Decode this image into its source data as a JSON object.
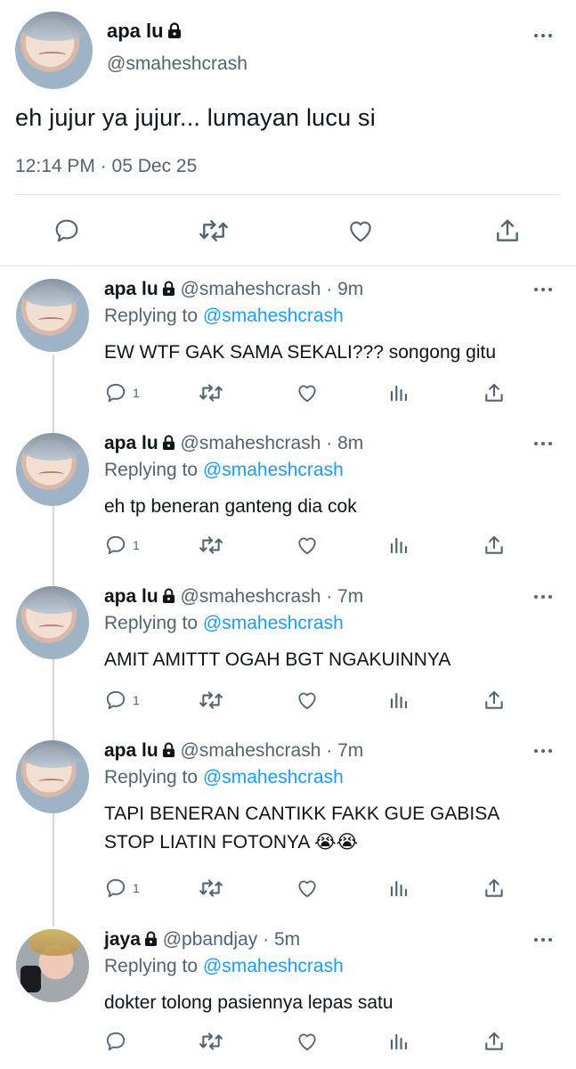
{
  "main_tweet": {
    "author_name": "apa lu",
    "author_handle": "@smaheshcrash",
    "text": "eh jujur ya jujur... lumayan lucu si",
    "timestamp": "12:14 PM · 05 Dec 25",
    "icons": [
      "lock-icon",
      "more-icon",
      "reply-icon",
      "retweet-icon",
      "like-icon",
      "share-icon"
    ]
  },
  "replies": [
    {
      "name": "apa lu",
      "handle": "@smaheshcrash",
      "time": "9m",
      "replying_label": "Replying to",
      "replying_to": "@smaheshcrash",
      "text": "EW WTF GAK SAMA SEKALI??? songong gitu",
      "reply_count": "1"
    },
    {
      "name": "apa lu",
      "handle": "@smaheshcrash",
      "time": "8m",
      "replying_label": "Replying to",
      "replying_to": "@smaheshcrash",
      "text": "eh tp beneran ganteng dia cok",
      "reply_count": "1"
    },
    {
      "name": "apa lu",
      "handle": "@smaheshcrash",
      "time": "7m",
      "replying_label": "Replying to",
      "replying_to": "@smaheshcrash",
      "text": "AMIT AMITTT OGAH BGT NGAKUINNYA",
      "reply_count": "1"
    },
    {
      "name": "apa lu",
      "handle": "@smaheshcrash",
      "time": "7m",
      "replying_label": "Replying to",
      "replying_to": "@smaheshcrash",
      "text": "TAPI BENERAN CANTIKK FAKK GUE GABISA STOP LIATIN FOTONYA 😭😭",
      "reply_count": "1"
    },
    {
      "name": "jaya",
      "handle": "@pbandjay",
      "time": "5m",
      "replying_label": "Replying to",
      "replying_to": "@smaheshcrash",
      "text": "dokter tolong pasiennya lepas satu",
      "reply_count": ""
    }
  ],
  "separator": "·",
  "colors": {
    "link": "#1d9bf0",
    "secondary": "#536471",
    "divider": "#e1e8ed"
  }
}
